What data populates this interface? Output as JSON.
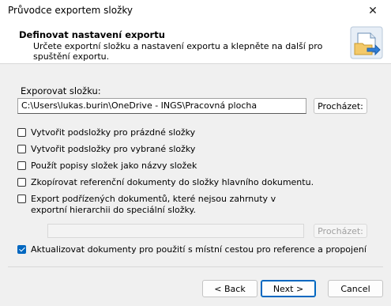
{
  "window": {
    "title": "Průvodce exportem složky",
    "close_glyph": "✕"
  },
  "header": {
    "title": "Definovat nastavení exportu",
    "description": "Určete exportní složku a nastavení exportu a klepněte na další pro spuštění exportu.",
    "icon": "export-folder-icon"
  },
  "export": {
    "label": "Exporovat složku:",
    "path": "C:\\Users\\lukas.burin\\OneDrive - INGS\\Pracovná plocha",
    "browse_label": "Procházet:"
  },
  "options": [
    {
      "label": "Vytvořit podsložky pro prázdné složky",
      "checked": false
    },
    {
      "label": "Vytvořit podsložky pro vybrané složky",
      "checked": false
    },
    {
      "label": "Použít popisy složek jako názvy složek",
      "checked": false
    },
    {
      "label": "Zkopírovat referenční dokumenty do složky hlavního dokumentu.",
      "checked": false
    },
    {
      "label": "Export podřízených dokumentů, které nejsou zahrnuty v exportní hierarchii do speciální složky.",
      "checked": false
    },
    {
      "label": "Aktualizovat dokumenty pro použití s místní cestou pro reference a propojení",
      "checked": true
    }
  ],
  "special_folder": {
    "value": "",
    "browse_label": "Procházet:"
  },
  "footer": {
    "back_label": "< Back",
    "next_label": "Next >",
    "cancel_label": "Cancel"
  },
  "colors": {
    "accent": "#0067c0",
    "header_bg": "#ffffff",
    "body_bg": "#f0f0f0"
  }
}
